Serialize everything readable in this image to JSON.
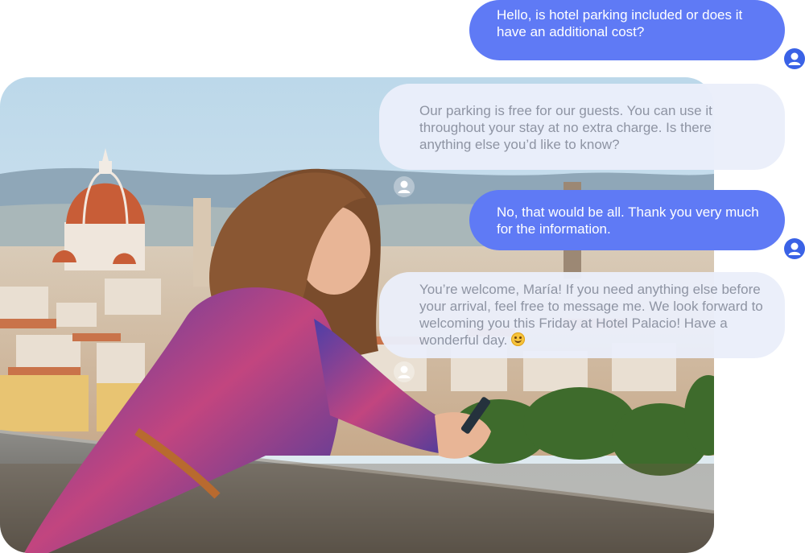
{
  "photo": {
    "icon": "florence-balcony-photo",
    "alt": ""
  },
  "messages": [
    {
      "direction": "outgoing",
      "text": "Hello, is hotel parking included or does it have an additional cost?"
    },
    {
      "direction": "incoming",
      "text": "Our parking is free for our guests. You can use it throughout your stay at no extra charge. Is there anything else you’d like to know?"
    },
    {
      "direction": "outgoing",
      "text": "No, that would be all. Thank you very much for the information."
    },
    {
      "direction": "incoming",
      "text": "You’re welcome, María! If you need anything else before your arrival, feel free to message me. We look forward to welcoming you this Friday at Hotel Palacio! Have a wonderful day.",
      "emoji": "smiling-face-icon"
    }
  ],
  "colors": {
    "outgoing_bubble": "#5f7af5",
    "incoming_bubble": "#eaeefa",
    "incoming_text": "#8e94a3",
    "avatar": "#3a62e6"
  },
  "icons": {
    "user_avatar": "user-avatar-icon",
    "agent_avatar": "agent-avatar-icon"
  }
}
